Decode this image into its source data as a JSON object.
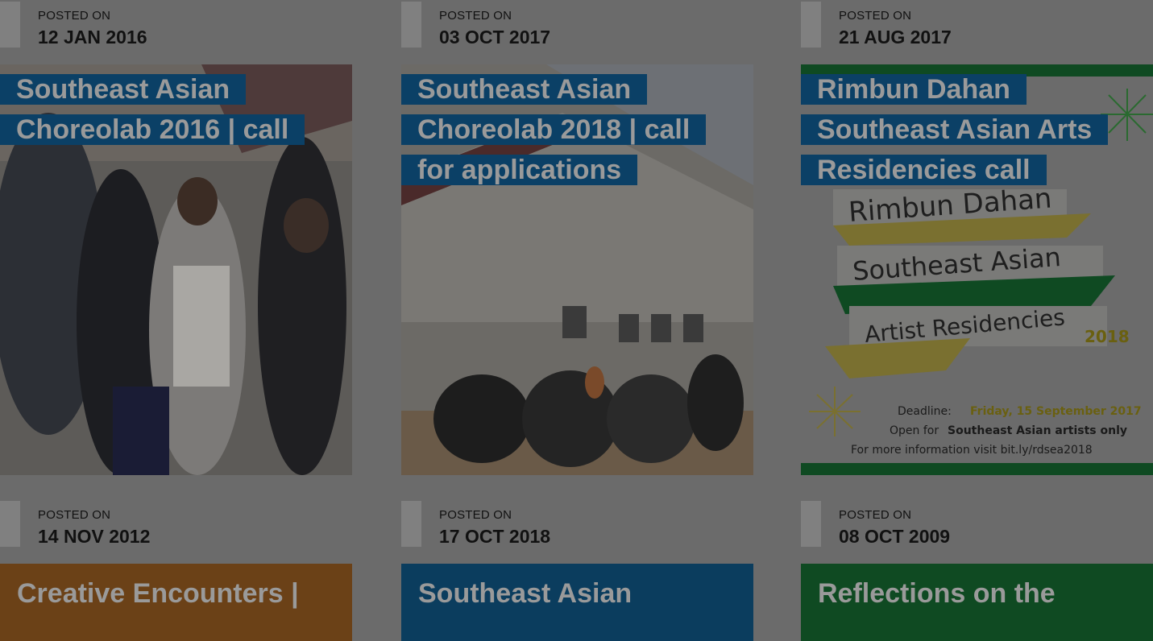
{
  "posted_label": "POSTED ON",
  "row1": [
    {
      "date": "12 JAN 2016",
      "title": "Southeast Asian Choreolab 2016 | call"
    },
    {
      "date": "03 OCT 2017",
      "title": "Southeast Asian Choreolab 2018 | call for applications"
    },
    {
      "date": "21 AUG 2017",
      "title": "Rimbun Dahan Southeast Asian Arts Residencies call",
      "poster": {
        "line1": "Rimbun Dahan",
        "line2": "Southeast Asian",
        "line3": "Artist Residencies",
        "year": "2018",
        "deadline_label": "Deadline:",
        "deadline_value": "Friday, 15 September 2017",
        "open_label": "Open for",
        "open_value": "Southeast Asian artists only",
        "info": "For more information visit bit.ly/rdsea2018"
      }
    }
  ],
  "row2": [
    {
      "date": "14 NOV 2012",
      "title": "Creative Encounters |",
      "color": "#6b4117"
    },
    {
      "date": "17 OCT 2018",
      "title": "Southeast Asian",
      "color": "#0b3d5e"
    },
    {
      "date": "08 OCT 2009",
      "title": "Reflections on the",
      "color": "#0f4a22"
    }
  ]
}
